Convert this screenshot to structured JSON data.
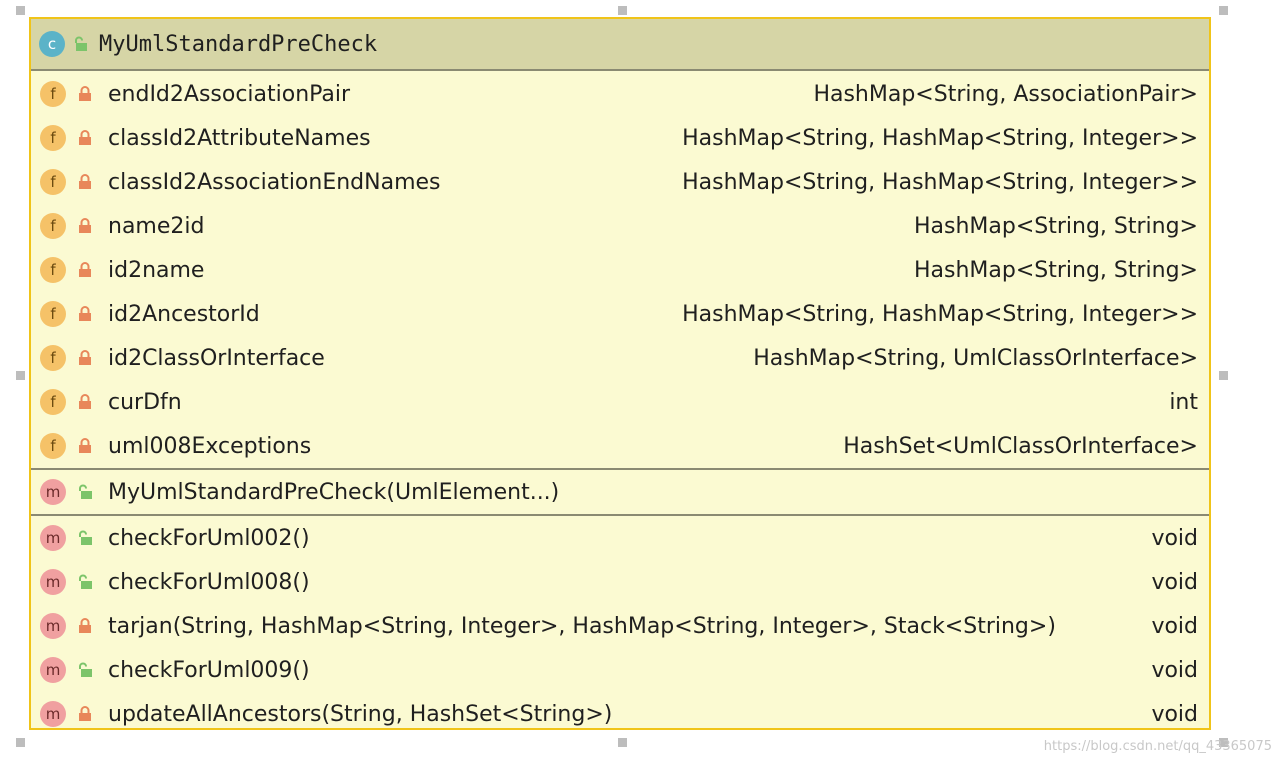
{
  "class": {
    "kind_badge": "c",
    "name": "MyUmlStandardPreCheck",
    "visibility": "public"
  },
  "fields": [
    {
      "badge": "f",
      "visibility": "private",
      "name": "endId2AssociationPair",
      "type": "HashMap<String, AssociationPair>"
    },
    {
      "badge": "f",
      "visibility": "private",
      "name": "classId2AttributeNames",
      "type": "HashMap<String, HashMap<String, Integer>>"
    },
    {
      "badge": "f",
      "visibility": "private",
      "name": "classId2AssociationEndNames",
      "type": "HashMap<String, HashMap<String, Integer>>"
    },
    {
      "badge": "f",
      "visibility": "private",
      "name": "name2id",
      "type": "HashMap<String, String>"
    },
    {
      "badge": "f",
      "visibility": "private",
      "name": "id2name",
      "type": "HashMap<String, String>"
    },
    {
      "badge": "f",
      "visibility": "private",
      "name": "id2AncestorId",
      "type": "HashMap<String, HashMap<String, Integer>>"
    },
    {
      "badge": "f",
      "visibility": "private",
      "name": "id2ClassOrInterface",
      "type": "HashMap<String, UmlClassOrInterface>"
    },
    {
      "badge": "f",
      "visibility": "private",
      "name": "curDfn",
      "type": "int"
    },
    {
      "badge": "f",
      "visibility": "private",
      "name": "uml008Exceptions",
      "type": "HashSet<UmlClassOrInterface>"
    }
  ],
  "constructors": [
    {
      "badge": "m",
      "visibility": "public",
      "name": "MyUmlStandardPreCheck(UmlElement...)"
    }
  ],
  "methods": [
    {
      "badge": "m",
      "visibility": "public",
      "name": "checkForUml002()",
      "type": "void"
    },
    {
      "badge": "m",
      "visibility": "public",
      "name": "checkForUml008()",
      "type": "void"
    },
    {
      "badge": "m",
      "visibility": "private",
      "name": "tarjan(String, HashMap<String, Integer>, HashMap<String, Integer>, Stack<String>)",
      "type": "void"
    },
    {
      "badge": "m",
      "visibility": "public",
      "name": "checkForUml009()",
      "type": "void"
    },
    {
      "badge": "m",
      "visibility": "private",
      "name": "updateAllAncestors(String, HashSet<String>)",
      "type": "void"
    }
  ],
  "colors": {
    "box_background": "#fbfad2",
    "box_border": "#f0c419",
    "header_background": "#d6d5a6",
    "class_badge": "#5bb3c8",
    "field_badge": "#f5c268",
    "method_badge": "#f0a0a0",
    "lock_private": "#e8875a",
    "lock_public": "#7cc46a"
  },
  "icons": {
    "class_badge": "class-icon",
    "field_badge": "field-icon",
    "method_badge": "method-icon",
    "private": "lock-closed-icon",
    "public": "lock-open-icon"
  },
  "watermark": "https://blog.csdn.net/qq_43365075"
}
